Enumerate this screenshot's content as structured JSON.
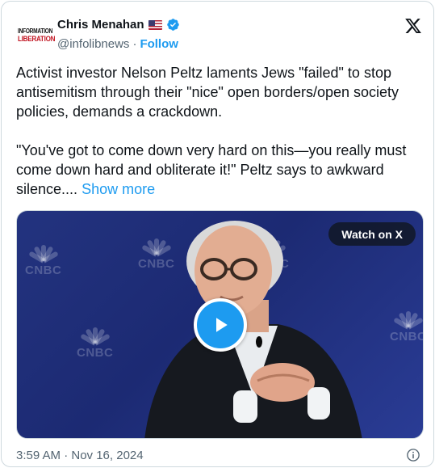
{
  "author": {
    "logo_line1": "INFORMATION",
    "logo_line2": "LIBERATION",
    "name": "Chris Menahan",
    "handle": "@infolibnews",
    "separator": "·",
    "follow_label": "Follow"
  },
  "tweet": {
    "text": "Activist investor Nelson Peltz laments Jews \"failed\" to stop antisemitism through their \"nice\" open borders/open society policies, demands a crackdown.\n\n\"You've got to come down very hard on this—you really must come down hard and obliterate it!\" Peltz says to awkward silence....",
    "show_more_label": "Show more"
  },
  "media": {
    "watch_label": "Watch on X",
    "backdrop_logo_text": "CNBC"
  },
  "footer": {
    "timestamp": "3:59 AM · Nov 16, 2024"
  },
  "icons": {
    "flag": "us-flag-icon",
    "verified": "verified-badge-icon",
    "x_logo": "x-logo-icon",
    "play": "play-icon",
    "info": "info-icon"
  },
  "colors": {
    "accent": "#1d9bf0",
    "text": "#0f1419",
    "secondary": "#536471",
    "logo_red": "#c1121f",
    "video_backdrop": "#23337f"
  }
}
